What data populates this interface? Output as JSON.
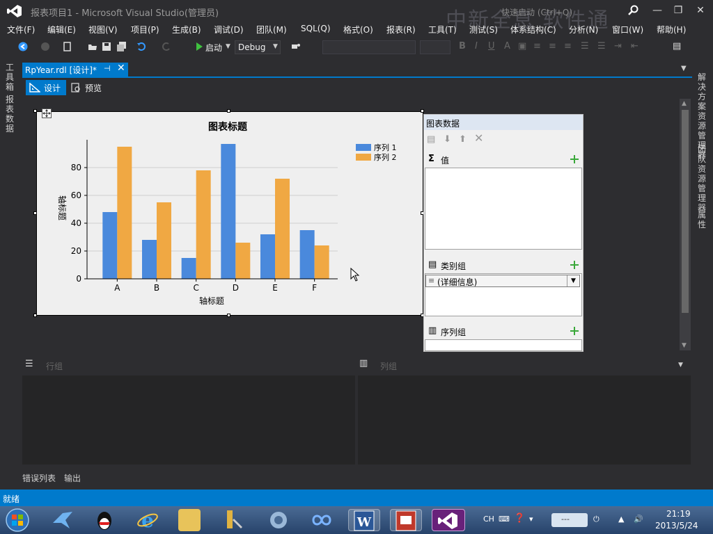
{
  "window": {
    "title": "报表项目1 - Microsoft Visual Studio(管理员)",
    "quick_launch_placeholder": "快速启动 (Ctrl+Q)",
    "watermark": "中新全息 软件通"
  },
  "menu": [
    "文件(F)",
    "编辑(E)",
    "视图(V)",
    "项目(P)",
    "生成(B)",
    "调试(D)",
    "团队(M)",
    "SQL(Q)",
    "格式(O)",
    "报表(R)",
    "工具(T)",
    "测试(S)",
    "体系结构(C)",
    "分析(N)",
    "窗口(W)",
    "帮助(H)"
  ],
  "toolbar": {
    "start_label": "启动",
    "config_value": "Debug"
  },
  "left_tabs": [
    "工具箱",
    "报表数据"
  ],
  "right_tabs": [
    "解决方案资源管理器",
    "团队资源管理器",
    "属性"
  ],
  "document_tab": {
    "label": "RpYear.rdl [设计]*"
  },
  "view_tabs": {
    "design": "设计",
    "preview": "预览"
  },
  "chart_data": {
    "type": "bar",
    "title": "图表标题",
    "xlabel": "轴标题",
    "ylabel": "轴标题",
    "categories": [
      "A",
      "B",
      "C",
      "D",
      "E",
      "F"
    ],
    "series": [
      {
        "name": "序列 1",
        "values": [
          48,
          28,
          15,
          97,
          32,
          35
        ],
        "color": "#4a89dc"
      },
      {
        "name": "序列 2",
        "values": [
          95,
          55,
          78,
          26,
          72,
          24
        ],
        "color": "#f0a843"
      }
    ],
    "ylim": [
      0,
      100
    ],
    "yticks": [
      0,
      20,
      40,
      60,
      80
    ],
    "grid": true,
    "legend": "top-right"
  },
  "chart_pane": {
    "title": "图表数据",
    "values_label": "值",
    "category_label": "类别组",
    "category_value": "(详细信息)",
    "series_label": "序列组"
  },
  "grouping": {
    "row_label": "行组",
    "col_label": "列组"
  },
  "output_tabs": [
    "错误列表",
    "输出"
  ],
  "status": "就绪",
  "taskbar": {
    "lang": "CH",
    "time": "21:19",
    "date": "2013/5/24"
  }
}
